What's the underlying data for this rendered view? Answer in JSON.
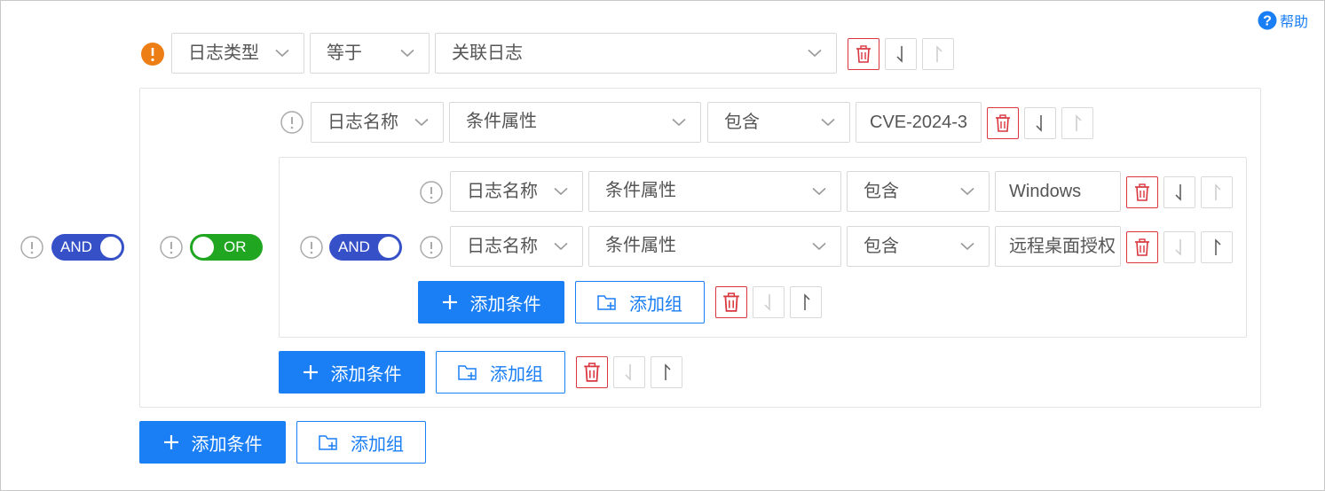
{
  "help": {
    "label": "帮助"
  },
  "colors": {
    "primary": "#1a7ef5",
    "and_toggle": "#3650c8",
    "or_toggle": "#21a621",
    "danger": "#d9363e",
    "warning": "#ed7e15"
  },
  "root": {
    "toggle": "AND",
    "condition": {
      "field": "日志类型",
      "operator": "等于",
      "value": "关联日志"
    },
    "add_condition": "添加条件",
    "add_group": "添加组"
  },
  "group1": {
    "toggle": "OR",
    "condition": {
      "field": "日志名称",
      "attribute": "条件属性",
      "operator": "包含",
      "value": "CVE-2024-3"
    },
    "add_condition": "添加条件",
    "add_group": "添加组"
  },
  "group2": {
    "toggle": "AND",
    "conditions": [
      {
        "field": "日志名称",
        "attribute": "条件属性",
        "operator": "包含",
        "value": "Windows"
      },
      {
        "field": "日志名称",
        "attribute": "条件属性",
        "operator": "包含",
        "value": "远程桌面授权"
      }
    ],
    "add_condition": "添加条件",
    "add_group": "添加组"
  }
}
